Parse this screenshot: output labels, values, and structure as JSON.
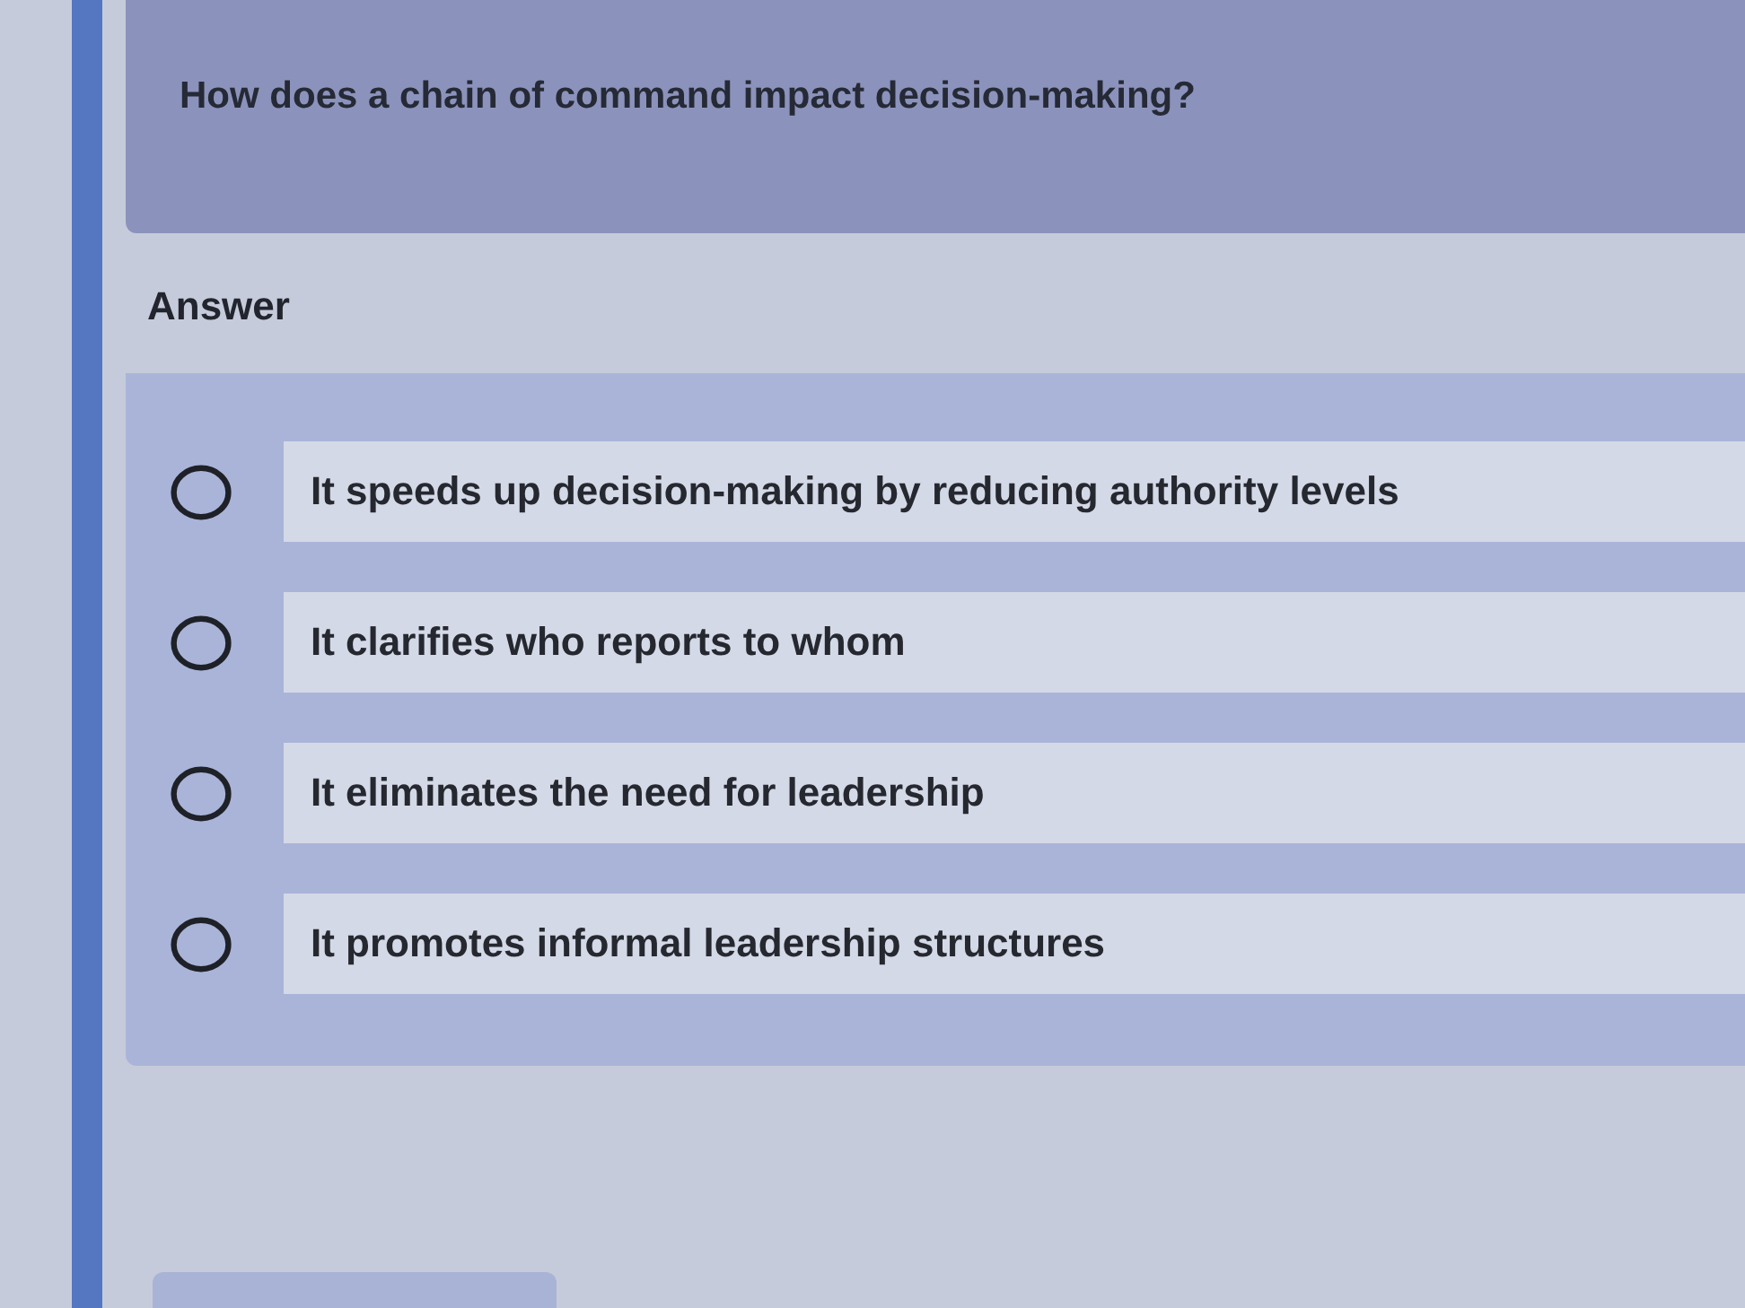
{
  "question": {
    "text": "How does a chain of command impact decision-making?"
  },
  "answer_label": "Answer",
  "options": [
    {
      "text": "It speeds up decision-making by reducing authority levels",
      "selected": false
    },
    {
      "text": "It clarifies who reports to whom",
      "selected": false
    },
    {
      "text": "It eliminates the need for leadership",
      "selected": false
    },
    {
      "text": "It promotes informal leadership structures",
      "selected": false
    }
  ]
}
